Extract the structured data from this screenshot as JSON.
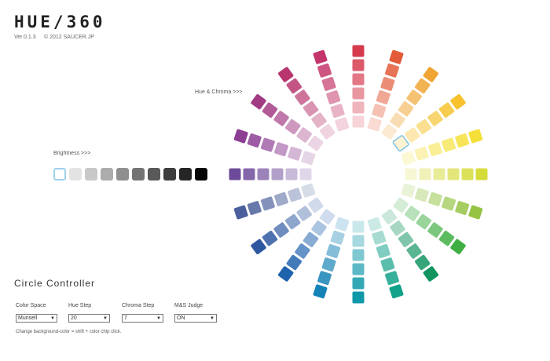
{
  "header": {
    "logo": "HUE/360",
    "version": "Ver.0.1.3",
    "copyright": "© 2012 SAUCER.JP"
  },
  "labels": {
    "hue_chroma": "Hue & Chroma >>>",
    "brightness": "Brightness >>>"
  },
  "brightness_chips": [
    "#ffffff",
    "#e3e3e3",
    "#c8c8c8",
    "#acacac",
    "#8f8f8f",
    "#747474",
    "#595959",
    "#3e3e3e",
    "#262626",
    "#050505"
  ],
  "wheel": {
    "hues": [
      "#d63a4d",
      "#e25a38",
      "#f0a532",
      "#f7c22e",
      "#f5e03a",
      "#d6db3c",
      "#95c445",
      "#3fae43",
      "#119460",
      "#11a088",
      "#1098a9",
      "#1583b5",
      "#1f62ad",
      "#2d58a0",
      "#4b5f9c",
      "#6d4b9a",
      "#8c3e93",
      "#a33b84",
      "#b8356e",
      "#c3356a"
    ],
    "selected_hue_index": 3,
    "selected_chroma_index": 5
  },
  "controller": {
    "title": "Circle Controller",
    "color_space_label": "Color Space",
    "color_space_value": "Munsell",
    "hue_step_label": "Hue Step",
    "hue_step_value": "20",
    "chroma_step_label": "Chroma Step",
    "chroma_step_value": "7",
    "ms_judge_label": "M&S Judge",
    "ms_judge_value": "ON",
    "hint": "Change background-color = shift + color chip click."
  }
}
